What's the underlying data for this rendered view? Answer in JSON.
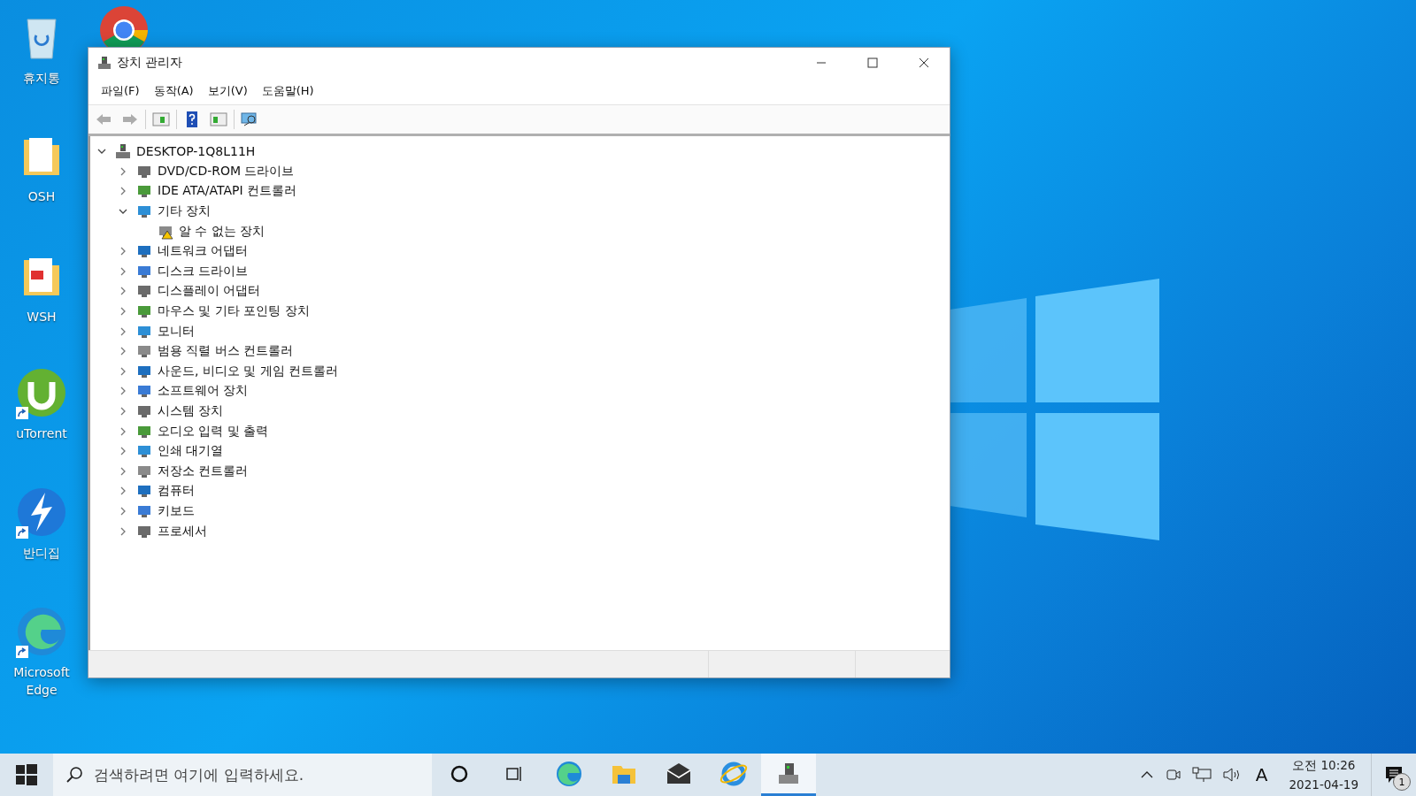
{
  "desktop": {
    "icons": [
      {
        "label": "휴지통",
        "shortcut": false
      },
      {
        "label": "OSH",
        "shortcut": false
      },
      {
        "label": "WSH",
        "shortcut": false
      },
      {
        "label": "uTorrent",
        "shortcut": true
      },
      {
        "label": "반디집",
        "shortcut": true
      },
      {
        "label": "Microsoft Edge",
        "shortcut": true
      }
    ]
  },
  "window": {
    "title": "장치 관리자",
    "menu": [
      "파일(F)",
      "동작(A)",
      "보기(V)",
      "도움말(H)"
    ],
    "toolbar": [
      {
        "disabled": true
      },
      {
        "disabled": true
      },
      {
        "disabled": false
      },
      {
        "disabled": false
      },
      {
        "disabled": false
      },
      {
        "disabled": false
      }
    ],
    "tree": [
      {
        "label": "DESKTOP-1Q8L11H",
        "expanded": true,
        "children": [
          {
            "label": "DVD/CD-ROM 드라이브",
            "expanded": false
          },
          {
            "label": "IDE ATA/ATAPI 컨트롤러",
            "expanded": false
          },
          {
            "label": "기타 장치",
            "expanded": true,
            "children": [
              {
                "label": "알 수 없는 장치",
                "warning": true
              }
            ]
          },
          {
            "label": "네트워크 어댑터",
            "expanded": false
          },
          {
            "label": "디스크 드라이브",
            "expanded": false
          },
          {
            "label": "디스플레이 어댑터",
            "expanded": false
          },
          {
            "label": "마우스 및 기타 포인팅 장치",
            "expanded": false
          },
          {
            "label": "모니터",
            "expanded": false
          },
          {
            "label": "범용 직렬 버스 컨트롤러",
            "expanded": false
          },
          {
            "label": "사운드, 비디오 및 게임 컨트롤러",
            "expanded": false
          },
          {
            "label": "소프트웨어 장치",
            "expanded": false
          },
          {
            "label": "시스템 장치",
            "expanded": false
          },
          {
            "label": "오디오 입력 및 출력",
            "expanded": false
          },
          {
            "label": "인쇄 대기열",
            "expanded": false
          },
          {
            "label": "저장소 컨트롤러",
            "expanded": false
          },
          {
            "label": "컴퓨터",
            "expanded": false
          },
          {
            "label": "키보드",
            "expanded": false
          },
          {
            "label": "프로세서",
            "expanded": false
          }
        ]
      }
    ]
  },
  "taskbar": {
    "search": {
      "placeholder": "검색하려면 여기에 입력하세요."
    },
    "apps": [
      {
        "selected": false
      },
      {
        "selected": false
      },
      {
        "selected": false
      },
      {
        "selected": false
      },
      {
        "selected": false
      },
      {
        "selected": false
      },
      {
        "selected": true
      }
    ],
    "input_indicator": "A",
    "time": "오전 10:26",
    "date": "2021-04-19",
    "notifications": "1"
  }
}
